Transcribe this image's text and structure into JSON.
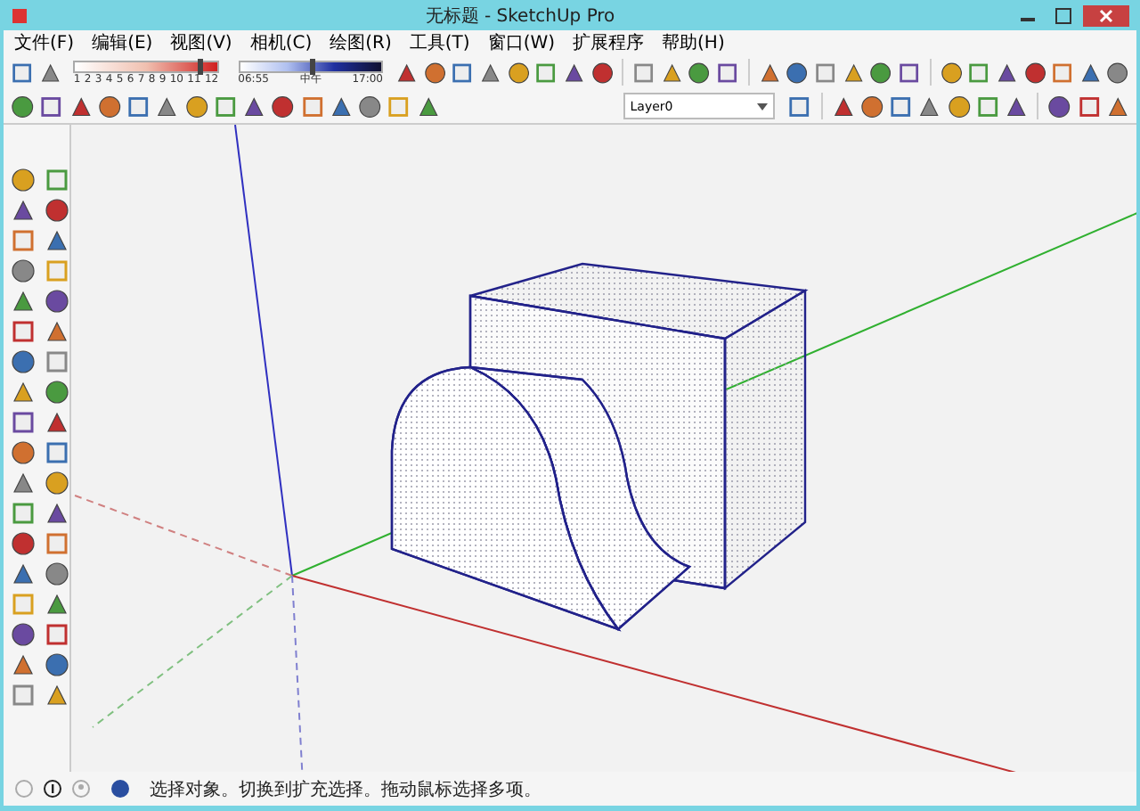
{
  "window": {
    "title": "无标题 - SketchUp Pro"
  },
  "menu": [
    "文件(F)",
    "编辑(E)",
    "视图(V)",
    "相机(C)",
    "绘图(R)",
    "工具(T)",
    "窗口(W)",
    "扩展程序",
    "帮助(H)"
  ],
  "shadow_month": {
    "labels": [
      "1",
      "2",
      "3",
      "4",
      "5",
      "6",
      "7",
      "8",
      "9",
      "10",
      "11",
      "12"
    ],
    "level": 0.86
  },
  "shadow_time": {
    "start": "06:55",
    "middle": "中午",
    "end": "17:00",
    "level": 0.5
  },
  "layer_dropdown": {
    "value": "Layer0"
  },
  "status_bar": {
    "text": "选择对象。切换到扩充选择。拖动鼠标选择多项。"
  }
}
